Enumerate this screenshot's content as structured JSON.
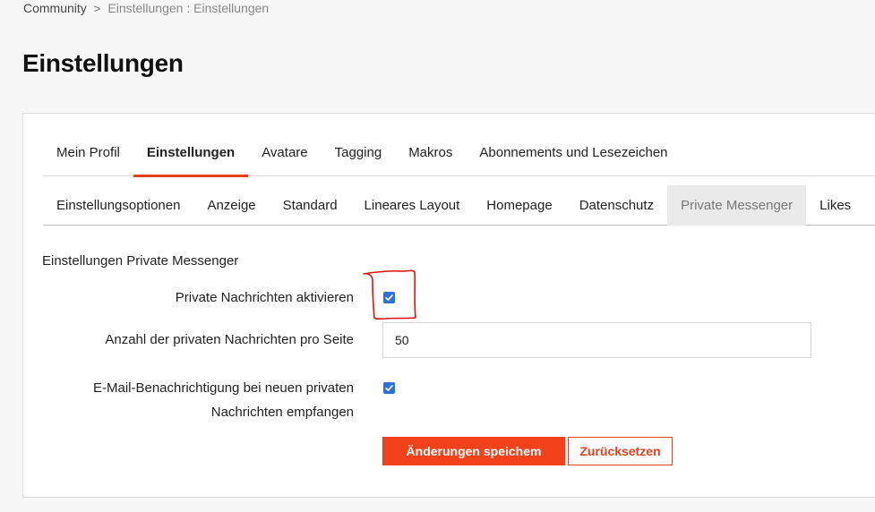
{
  "breadcrumb": {
    "root": "Community",
    "separator": ">",
    "current": "Einstellungen : Einstellungen"
  },
  "page": {
    "title": "Einstellungen"
  },
  "tabs_main": [
    {
      "label": "Mein Profil",
      "active": false
    },
    {
      "label": "Einstellungen",
      "active": true
    },
    {
      "label": "Avatare",
      "active": false
    },
    {
      "label": "Tagging",
      "active": false
    },
    {
      "label": "Makros",
      "active": false
    },
    {
      "label": "Abonnements und Lesezeichen",
      "active": false
    }
  ],
  "tabs_sub": [
    {
      "label": "Einstellungsoptionen",
      "active": false
    },
    {
      "label": "Anzeige",
      "active": false
    },
    {
      "label": "Standard",
      "active": false
    },
    {
      "label": "Lineares Layout",
      "active": false
    },
    {
      "label": "Homepage",
      "active": false
    },
    {
      "label": "Datenschutz",
      "active": false
    },
    {
      "label": "Private Messenger",
      "active": true
    },
    {
      "label": "Likes",
      "active": false
    }
  ],
  "form": {
    "section_title": "Einstellungen Private Messenger",
    "enable_pm": {
      "label": "Private Nachrichten aktivieren",
      "checked": true
    },
    "per_page": {
      "label": "Anzahl der privaten Nachrichten pro Seite",
      "value": "50"
    },
    "email_notify": {
      "label_line1": "E-Mail-Benachrichtigung bei neuen privaten",
      "label_line2": "Nachrichten empfangen",
      "checked": true
    },
    "save_label": "Änderungen speichem",
    "reset_label": "Zurücksetzen"
  },
  "colors": {
    "accent": "#e8401c",
    "button_primary": "#f2421b",
    "checkbox": "#2f6fd8",
    "annotation": "#e01010"
  },
  "icons": {
    "checkmark": "checkmark-icon",
    "breadcrumb_separator": "chevron-right-icon"
  }
}
